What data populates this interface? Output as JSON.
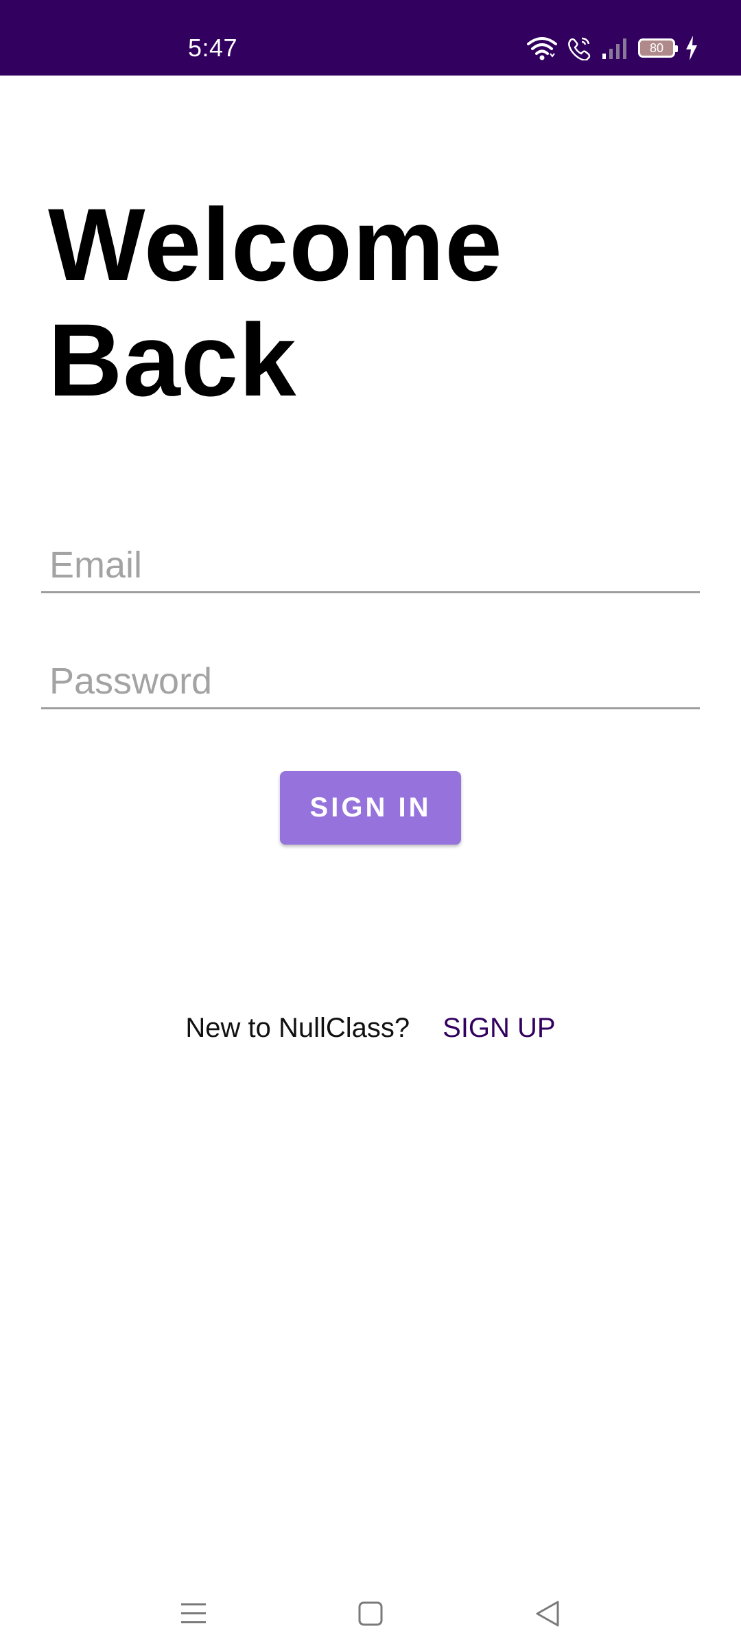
{
  "status_bar": {
    "time": "5:47",
    "battery_level": "80",
    "background_color": "#32005e"
  },
  "welcome": {
    "line1": "Welcome",
    "line2": "Back"
  },
  "form": {
    "email_placeholder": "Email",
    "password_placeholder": "Password",
    "signin_label": "SIGN IN",
    "signin_color": "#9572dc"
  },
  "signup": {
    "prompt": "New to NullClass?",
    "link_label": "SIGN UP",
    "link_color": "#32005e"
  },
  "nav_bar": {
    "icons": [
      "menu-icon",
      "home-square-icon",
      "back-triangle-icon"
    ]
  }
}
